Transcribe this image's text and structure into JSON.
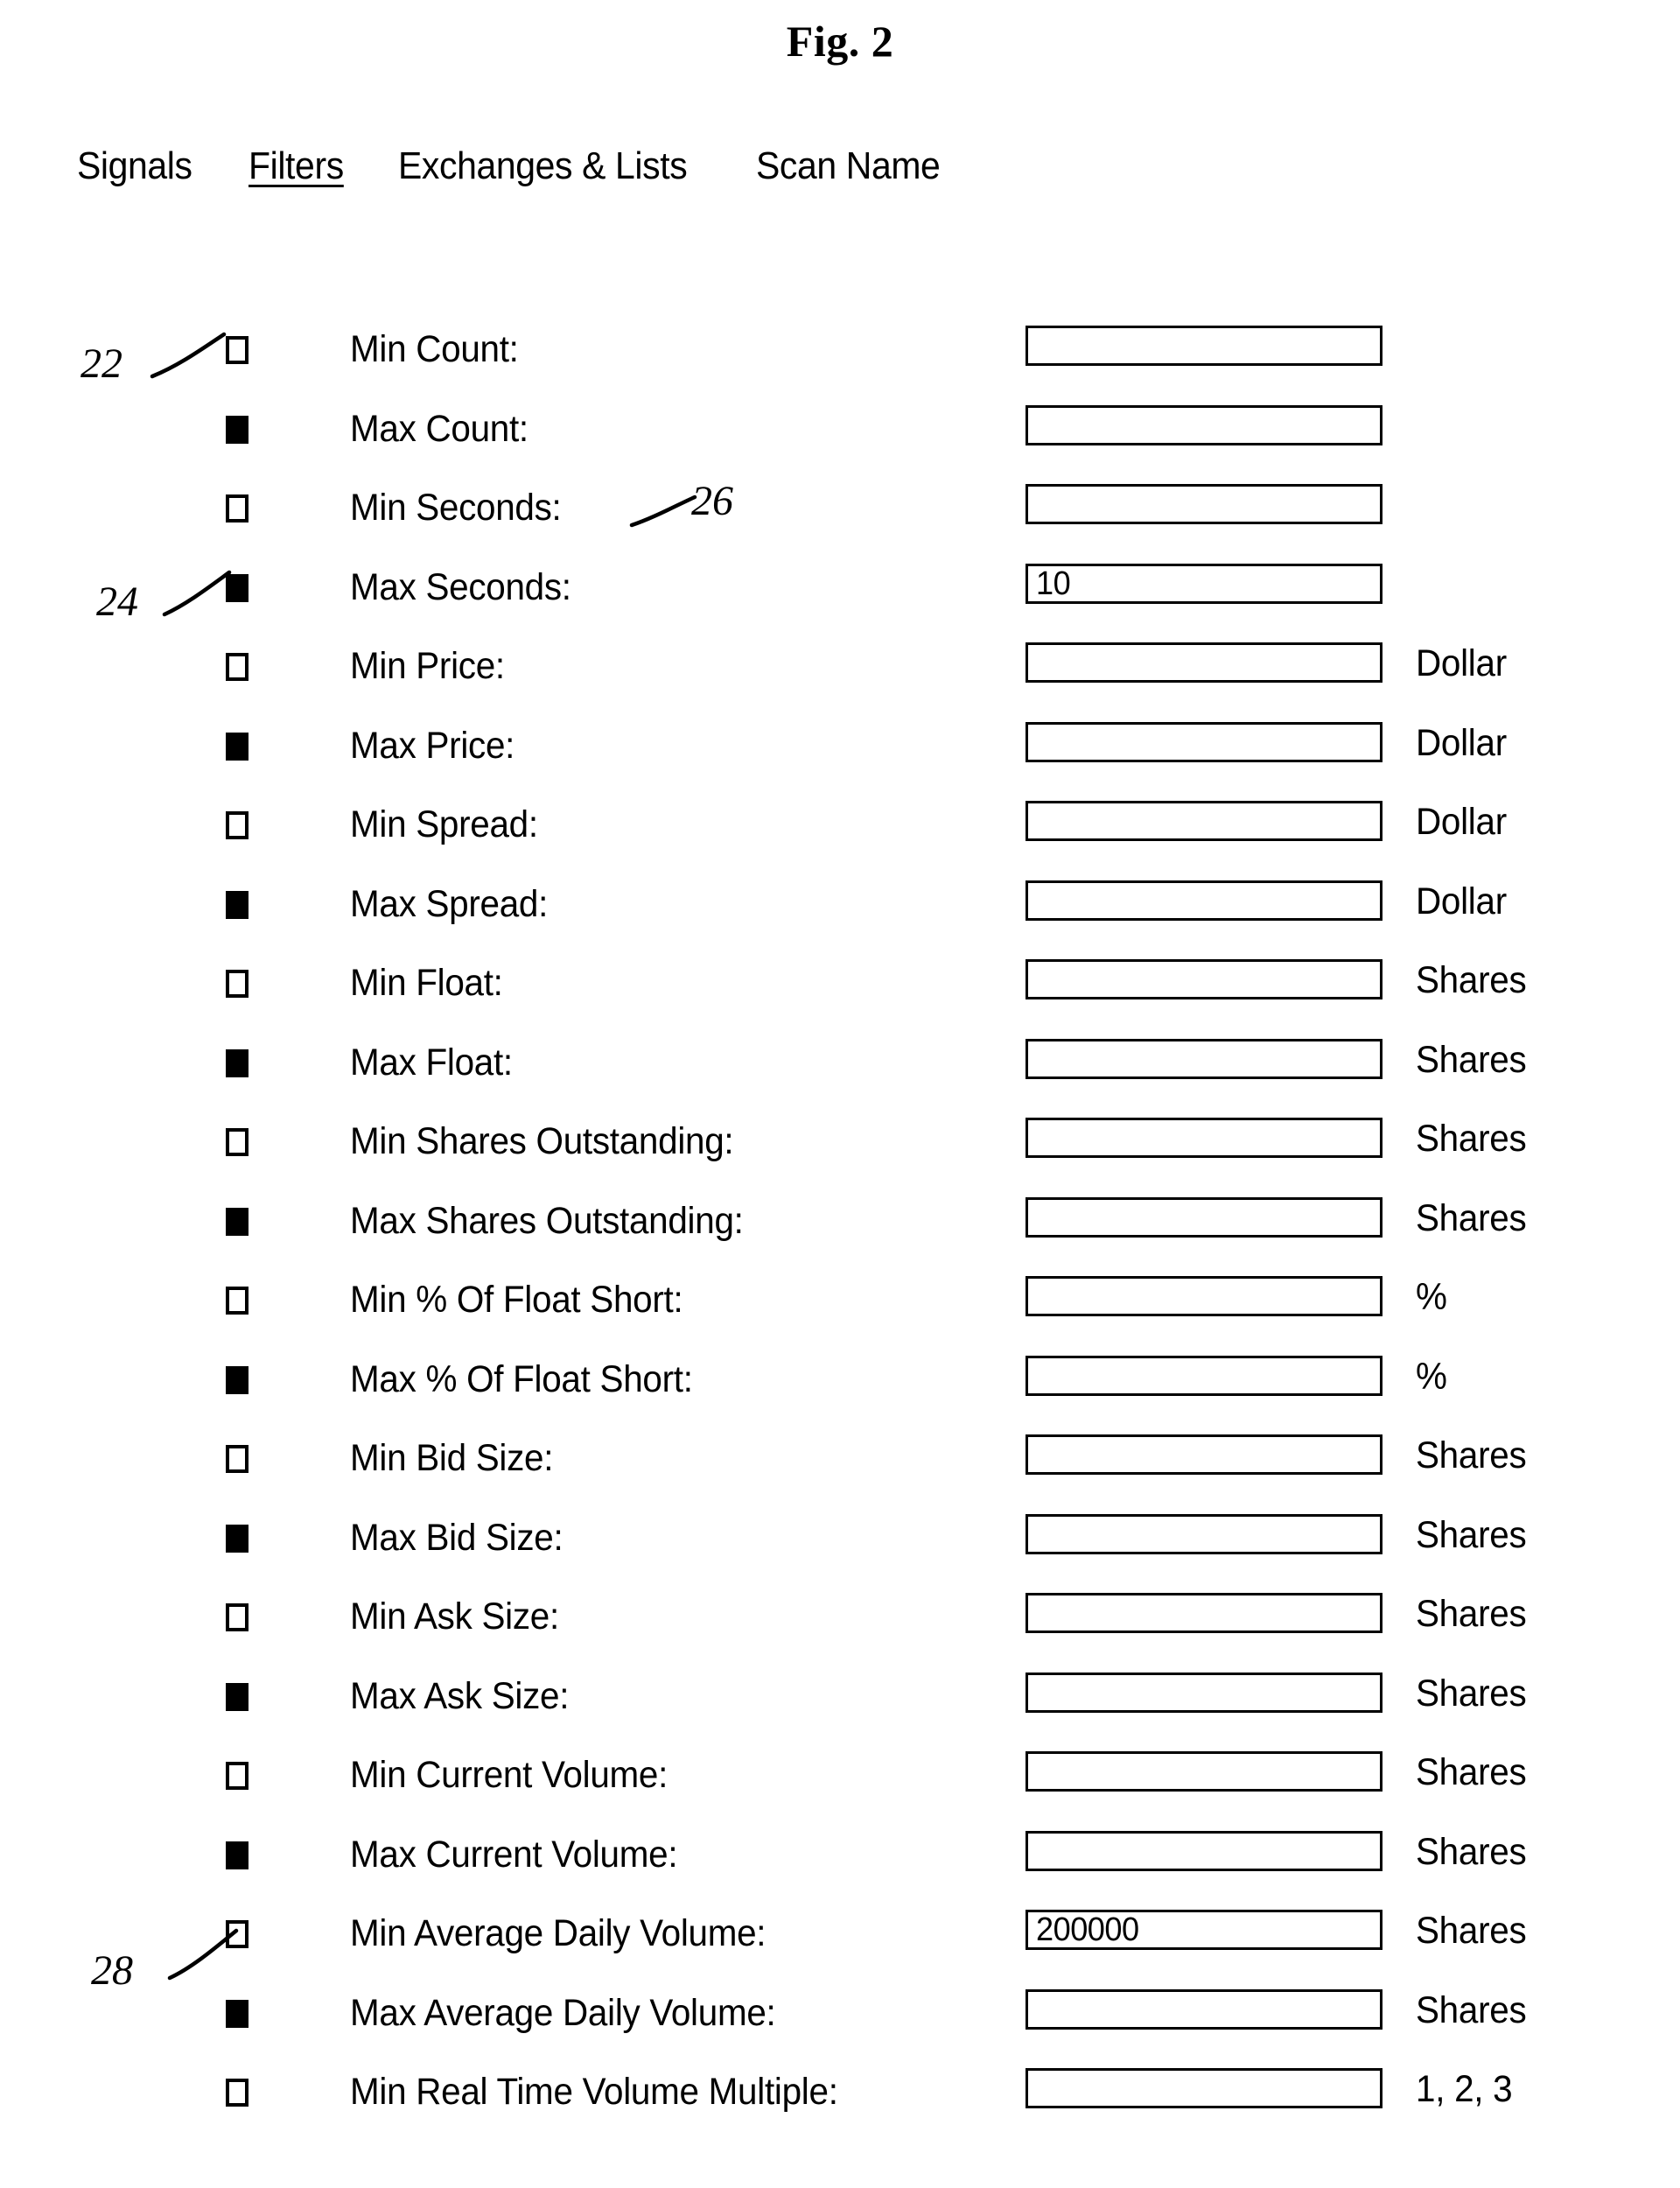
{
  "figure": {
    "title": "Fig. 2"
  },
  "tabs": [
    {
      "label": "Signals",
      "active": false
    },
    {
      "label": "Filters",
      "active": true
    },
    {
      "label": "Exchanges & Lists",
      "active": false
    },
    {
      "label": "Scan Name",
      "active": false
    }
  ],
  "filters": [
    {
      "checked": false,
      "label": "Min Count:",
      "value": "",
      "unit": ""
    },
    {
      "checked": true,
      "label": "Max Count:",
      "value": "",
      "unit": ""
    },
    {
      "checked": false,
      "label": "Min Seconds:",
      "value": "",
      "unit": ""
    },
    {
      "checked": true,
      "label": "Max Seconds:",
      "value": "10",
      "unit": ""
    },
    {
      "checked": false,
      "label": "Min Price:",
      "value": "",
      "unit": "Dollar"
    },
    {
      "checked": true,
      "label": "Max Price:",
      "value": "",
      "unit": "Dollar"
    },
    {
      "checked": false,
      "label": "Min Spread:",
      "value": "",
      "unit": "Dollar"
    },
    {
      "checked": true,
      "label": "Max Spread:",
      "value": "",
      "unit": "Dollar"
    },
    {
      "checked": false,
      "label": "Min Float:",
      "value": "",
      "unit": "Shares"
    },
    {
      "checked": true,
      "label": "Max Float:",
      "value": "",
      "unit": "Shares"
    },
    {
      "checked": false,
      "label": "Min Shares Outstanding:",
      "value": "",
      "unit": "Shares"
    },
    {
      "checked": true,
      "label": "Max Shares Outstanding:",
      "value": "",
      "unit": "Shares"
    },
    {
      "checked": false,
      "label": "Min % Of Float Short:",
      "value": "",
      "unit": "%"
    },
    {
      "checked": true,
      "label": "Max % Of Float Short:",
      "value": "",
      "unit": "%"
    },
    {
      "checked": false,
      "label": "Min Bid Size:",
      "value": "",
      "unit": "Shares"
    },
    {
      "checked": true,
      "label": "Max Bid Size:",
      "value": "",
      "unit": "Shares"
    },
    {
      "checked": false,
      "label": "Min Ask Size:",
      "value": "",
      "unit": "Shares"
    },
    {
      "checked": true,
      "label": "Max Ask Size:",
      "value": "",
      "unit": "Shares"
    },
    {
      "checked": false,
      "label": "Min Current Volume:",
      "value": "",
      "unit": "Shares"
    },
    {
      "checked": true,
      "label": "Max Current Volume:",
      "value": "",
      "unit": "Shares"
    },
    {
      "checked": false,
      "label": "Min Average Daily Volume:",
      "value": "200000",
      "unit": "Shares"
    },
    {
      "checked": true,
      "label": "Max Average Daily Volume:",
      "value": "",
      "unit": "Shares"
    },
    {
      "checked": false,
      "label": "Min Real Time Volume Multiple:",
      "value": "",
      "unit": "1, 2, 3"
    }
  ],
  "reference_numerals": [
    {
      "id": "22",
      "target": "min-count-checkbox"
    },
    {
      "id": "24",
      "target": "max-seconds-checkbox"
    },
    {
      "id": "26",
      "target": "min-seconds-label"
    },
    {
      "id": "28",
      "target": "min-average-daily-volume-checkbox"
    }
  ]
}
